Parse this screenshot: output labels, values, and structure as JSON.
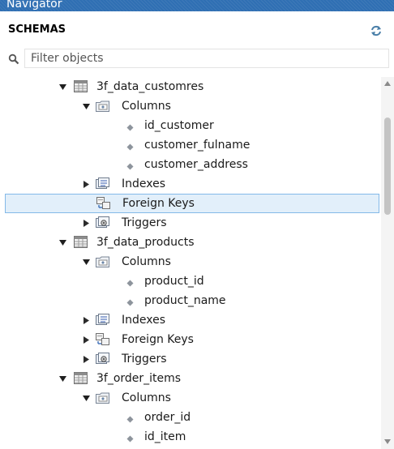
{
  "titlebar": {
    "title": "Navigator"
  },
  "schemas": {
    "label": "SCHEMAS",
    "refresh_icon": "refresh-icon"
  },
  "filter": {
    "placeholder": "Filter objects",
    "value": ""
  },
  "tree": [
    {
      "depth": 0,
      "toggle": "expanded",
      "icon": "table",
      "label": "3f_data_customres"
    },
    {
      "depth": 1,
      "toggle": "expanded",
      "icon": "columns-folder",
      "label": "Columns"
    },
    {
      "depth": 2,
      "toggle": "none",
      "icon": "column",
      "label": "id_customer"
    },
    {
      "depth": 2,
      "toggle": "none",
      "icon": "column",
      "label": "customer_fulname"
    },
    {
      "depth": 2,
      "toggle": "none",
      "icon": "column",
      "label": "customer_address"
    },
    {
      "depth": 1,
      "toggle": "collapsed",
      "icon": "indexes",
      "label": "Indexes"
    },
    {
      "depth": 1,
      "toggle": "none",
      "icon": "foreign-keys",
      "label": "Foreign Keys",
      "selected": true
    },
    {
      "depth": 1,
      "toggle": "collapsed",
      "icon": "triggers",
      "label": "Triggers"
    },
    {
      "depth": 0,
      "toggle": "expanded",
      "icon": "table",
      "label": "3f_data_products"
    },
    {
      "depth": 1,
      "toggle": "expanded",
      "icon": "columns-folder",
      "label": "Columns"
    },
    {
      "depth": 2,
      "toggle": "none",
      "icon": "column",
      "label": "product_id"
    },
    {
      "depth": 2,
      "toggle": "none",
      "icon": "column",
      "label": "product_name"
    },
    {
      "depth": 1,
      "toggle": "collapsed",
      "icon": "indexes",
      "label": "Indexes"
    },
    {
      "depth": 1,
      "toggle": "collapsed",
      "icon": "foreign-keys",
      "label": "Foreign Keys"
    },
    {
      "depth": 1,
      "toggle": "collapsed",
      "icon": "triggers",
      "label": "Triggers"
    },
    {
      "depth": 0,
      "toggle": "expanded",
      "icon": "table",
      "label": "3f_order_items"
    },
    {
      "depth": 1,
      "toggle": "expanded",
      "icon": "columns-folder",
      "label": "Columns"
    },
    {
      "depth": 2,
      "toggle": "none",
      "icon": "column",
      "label": "order_id"
    },
    {
      "depth": 2,
      "toggle": "none",
      "icon": "column",
      "label": "id_item"
    }
  ],
  "colors": {
    "titlebar": "#2f6fb3",
    "selection_bg": "#e2effa",
    "selection_border": "#84b9e8"
  }
}
